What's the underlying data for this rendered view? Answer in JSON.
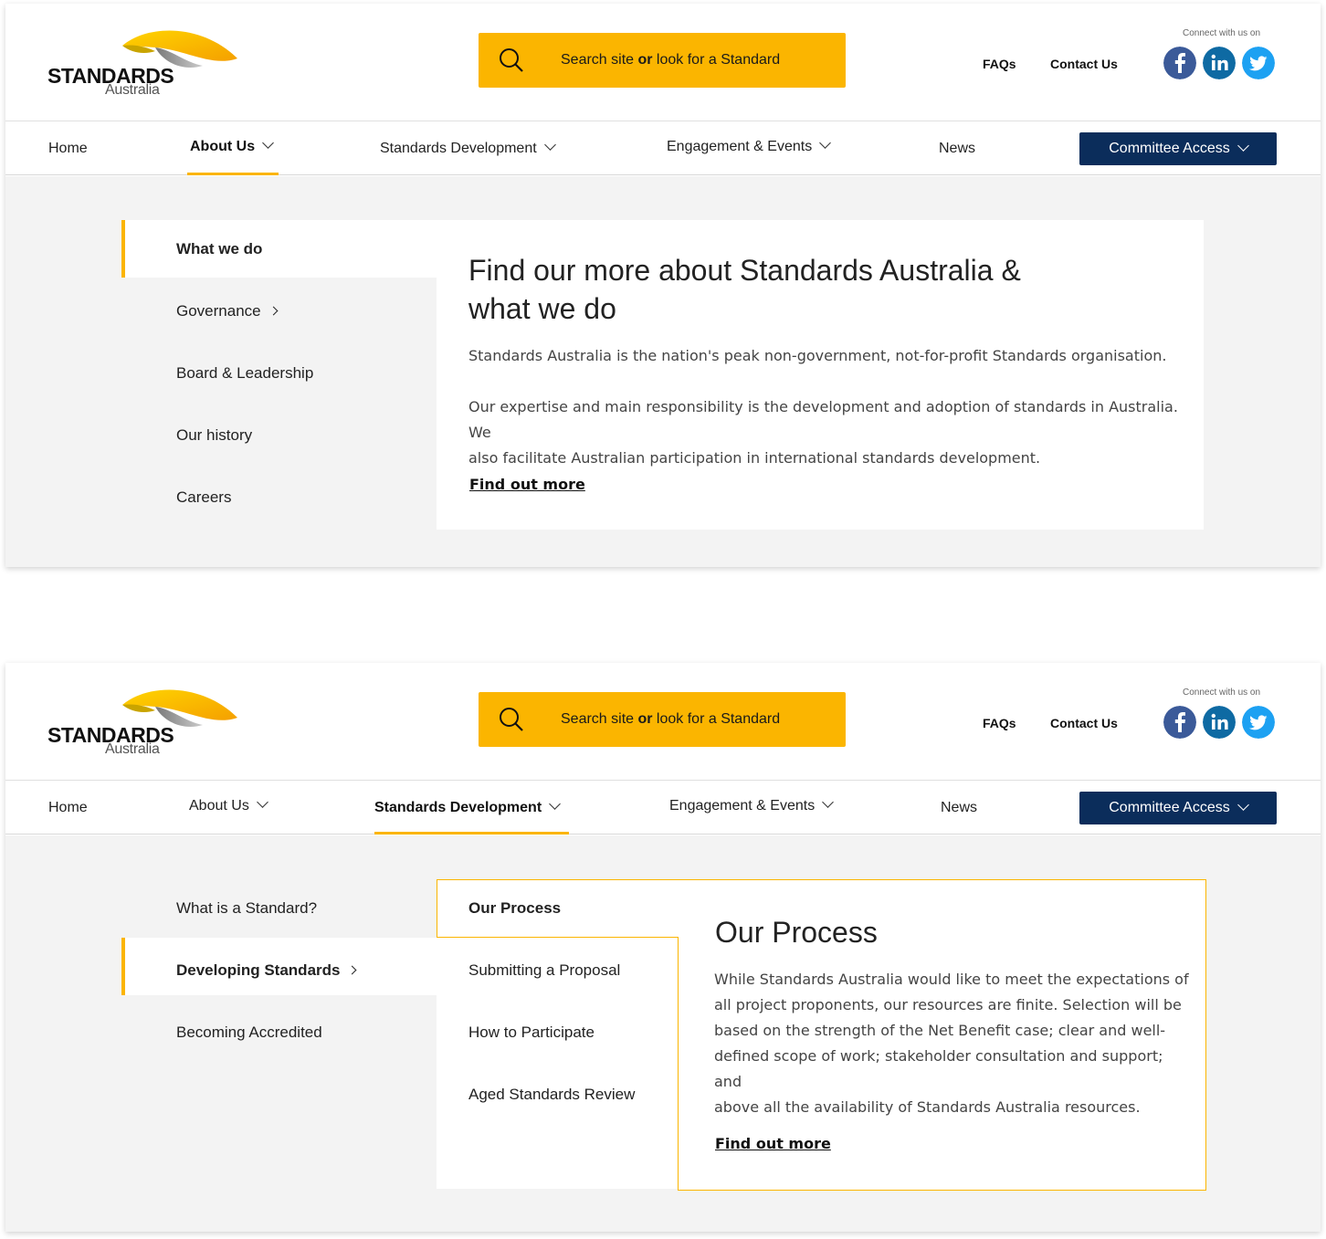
{
  "brand": {
    "logo_word": "STANDARDS",
    "logo_sub": "Australia"
  },
  "colors": {
    "accent": "#fbb500",
    "navy": "#0b2d5b",
    "facebook": "#3b5a99",
    "linkedin": "#0e6aa3",
    "twitter": "#1da1f2"
  },
  "header": {
    "search_prefix": "Search site ",
    "search_or": "or",
    "search_suffix": " look for a Standard",
    "faqs": "FAQs",
    "contact": "Contact Us",
    "connect": "Connect with us on",
    "social": [
      "facebook-icon",
      "linkedin-icon",
      "twitter-icon"
    ]
  },
  "nav": {
    "home": "Home",
    "about": "About Us",
    "standards_dev": "Standards Development",
    "engagement": "Engagement & Events",
    "news": "News",
    "committee": "Committee Access"
  },
  "panel1": {
    "menu": [
      "What we do",
      "Governance",
      "Board & Leadership",
      "Our history",
      "Careers"
    ],
    "title_line1": "Find our more about Standards Australia &",
    "title_line2": "what we do",
    "para1": "Standards Australia is the nation's peak non-government, not-for-profit Standards organisation.",
    "para2_line1": "Our expertise and main responsibility is the development and adoption of standards in Australia. We",
    "para2_line2": "also facilitate Australian participation in international standards development.",
    "more": "Find out more"
  },
  "panel2": {
    "menu": [
      "What is a Standard?",
      "Developing Standards",
      "Becoming Accredited"
    ],
    "submenu": [
      "Our Process",
      "Submitting a Proposal",
      "How to Participate",
      "Aged Standards Review"
    ],
    "title": "Our Process",
    "para_lines": [
      "While Standards Australia would like to meet the expectations of",
      "all project proponents, our resources are finite. Selection will be",
      "based on the strength of the Net Benefit case; clear and well-",
      "defined scope of work; stakeholder consultation and support; and",
      "above all the availability of Standards Australia resources."
    ],
    "more": "Find out more"
  }
}
